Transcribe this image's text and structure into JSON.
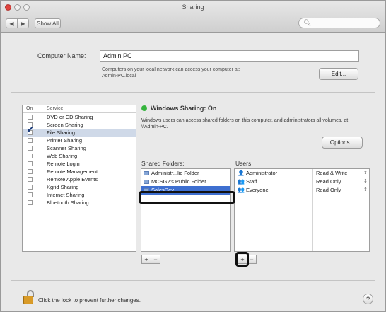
{
  "window": {
    "title": "Sharing"
  },
  "toolbar": {
    "back": "◀",
    "forward": "▶",
    "show_all": "Show All",
    "search_placeholder": ""
  },
  "computer_name": {
    "label": "Computer Name:",
    "value": "Admin PC",
    "description": "Computers on your local network can access your computer at: Admin-PC.local",
    "edit_label": "Edit..."
  },
  "services": {
    "header_on": "On",
    "header_service": "Service",
    "items": [
      {
        "label": "DVD or CD Sharing",
        "checked": false
      },
      {
        "label": "Screen Sharing",
        "checked": false
      },
      {
        "label": "File Sharing",
        "checked": true
      },
      {
        "label": "Printer Sharing",
        "checked": false
      },
      {
        "label": "Scanner Sharing",
        "checked": false
      },
      {
        "label": "Web Sharing",
        "checked": false
      },
      {
        "label": "Remote Login",
        "checked": false
      },
      {
        "label": "Remote Management",
        "checked": false
      },
      {
        "label": "Remote Apple Events",
        "checked": false
      },
      {
        "label": "Xgrid Sharing",
        "checked": false
      },
      {
        "label": "Internet Sharing",
        "checked": false
      },
      {
        "label": "Bluetooth Sharing",
        "checked": false
      }
    ]
  },
  "status": {
    "title": "Windows Sharing: On",
    "description": "Windows users can access shared folders on this computer, and administrators all volumes, at \\\\Admin-PC.",
    "options_label": "Options...",
    "color": "#35b43d"
  },
  "shared_folders": {
    "label": "Shared Folders:",
    "items": [
      {
        "label": "Administr...lic Folder",
        "selected": false
      },
      {
        "label": "MCSG2's Public Folder",
        "selected": false
      },
      {
        "label": "SalesDev",
        "selected": true
      }
    ],
    "add": "+",
    "remove": "−"
  },
  "users": {
    "label": "Users:",
    "items": [
      {
        "icon": "👤",
        "name": "Administrator",
        "permission": "Read & Write"
      },
      {
        "icon": "👥",
        "name": "Staff",
        "permission": "Read Only"
      },
      {
        "icon": "👥",
        "name": "Everyone",
        "permission": "Read Only"
      }
    ],
    "add": "+",
    "remove": "−",
    "stepper": "⇕"
  },
  "footer": {
    "lock_text": "Click the lock to prevent further changes.",
    "help": "?"
  }
}
